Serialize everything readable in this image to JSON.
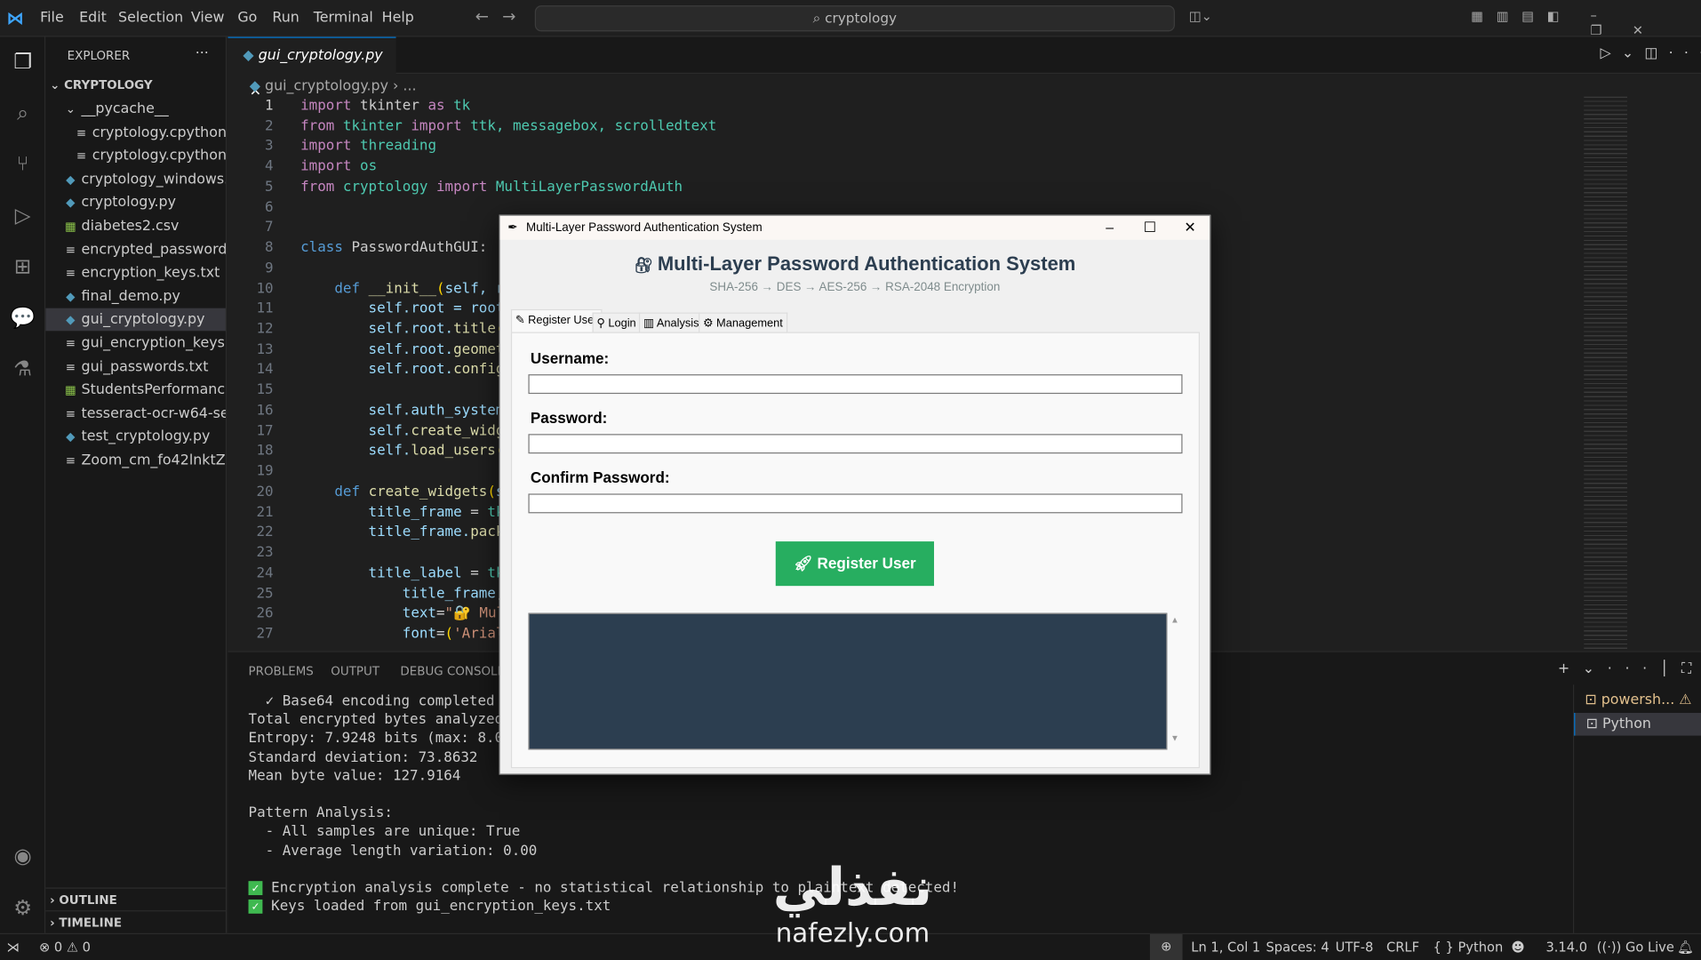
{
  "menu": [
    "File",
    "Edit",
    "Selection",
    "View",
    "Go",
    "Run",
    "Terminal",
    "Help"
  ],
  "search": "cryptology",
  "explorer": {
    "title": "EXPLORER",
    "root": "CRYPTOLOGY",
    "items": [
      {
        "label": "__pycache__",
        "type": "folder",
        "indent": 1
      },
      {
        "label": "cryptology.cpython-...",
        "type": "txt",
        "indent": 2
      },
      {
        "label": "cryptology.cpython-...",
        "type": "txt",
        "indent": 2
      },
      {
        "label": "cryptology_windows.py",
        "type": "py",
        "indent": 1
      },
      {
        "label": "cryptology.py",
        "type": "py",
        "indent": 1
      },
      {
        "label": "diabetes2.csv",
        "type": "csv",
        "indent": 1
      },
      {
        "label": "encrypted_passwords...",
        "type": "txt",
        "indent": 1
      },
      {
        "label": "encryption_keys.txt",
        "type": "txt",
        "indent": 1
      },
      {
        "label": "final_demo.py",
        "type": "py",
        "indent": 1
      },
      {
        "label": "gui_cryptology.py",
        "type": "py",
        "indent": 1,
        "selected": true
      },
      {
        "label": "gui_encryption_keys.txt",
        "type": "txt",
        "indent": 1
      },
      {
        "label": "gui_passwords.txt",
        "type": "txt",
        "indent": 1
      },
      {
        "label": "StudentsPerformance....",
        "type": "csv",
        "indent": 1
      },
      {
        "label": "tesseract-ocr-w64-set...",
        "type": "txt",
        "indent": 1
      },
      {
        "label": "test_cryptology.py",
        "type": "py",
        "indent": 1
      },
      {
        "label": "Zoom_cm_fo42lnktZ9...",
        "type": "txt",
        "indent": 1
      }
    ],
    "outline": "OUTLINE",
    "timeline": "TIMELINE"
  },
  "editor": {
    "tab": "gui_cryptology.py",
    "breadcrumb": "gui_cryptology.py",
    "breadcrumb_more": "...",
    "lines": [
      [
        [
          "import",
          "kw"
        ],
        [
          " tkinter ",
          ""
        ],
        [
          "as",
          "kw"
        ],
        [
          " tk",
          "cls"
        ]
      ],
      [
        [
          "from",
          "kw"
        ],
        [
          " tkinter ",
          "cls"
        ],
        [
          "import",
          "kw"
        ],
        [
          " ttk, messagebox, scrolledtext",
          "cls"
        ]
      ],
      [
        [
          "import",
          "kw"
        ],
        [
          " threading",
          "cls"
        ]
      ],
      [
        [
          "import",
          "kw"
        ],
        [
          " os",
          "cls"
        ]
      ],
      [
        [
          "from",
          "kw"
        ],
        [
          " cryptology ",
          "cls"
        ],
        [
          "import",
          "kw"
        ],
        [
          " MultiLayerPasswordAuth",
          "cls"
        ]
      ],
      [],
      [],
      [
        [
          "class",
          "kb"
        ],
        [
          " PasswordAuthGUI",
          ""
        ],
        [
          ":",
          ""
        ]
      ],
      [],
      [
        [
          "    def",
          "kb"
        ],
        [
          " __init__",
          "fn"
        ],
        [
          "(",
          "pn"
        ],
        [
          "self, r",
          "sf"
        ]
      ],
      [
        [
          "        self",
          "sf"
        ],
        [
          ".root = ",
          "sf"
        ],
        [
          "root",
          "sf"
        ]
      ],
      [
        [
          "        self",
          "sf"
        ],
        [
          ".root.",
          "sf"
        ],
        [
          "title",
          "fn"
        ],
        [
          "(",
          "pn"
        ]
      ],
      [
        [
          "        self",
          "sf"
        ],
        [
          ".root.",
          "sf"
        ],
        [
          "geomet",
          "fn"
        ]
      ],
      [
        [
          "        self",
          "sf"
        ],
        [
          ".root.",
          "sf"
        ],
        [
          "config",
          "fn"
        ]
      ],
      [],
      [
        [
          "        self",
          "sf"
        ],
        [
          ".auth_system",
          "sf"
        ]
      ],
      [
        [
          "        self",
          "sf"
        ],
        [
          ".",
          "sf"
        ],
        [
          "create_widg",
          "fn"
        ]
      ],
      [
        [
          "        self",
          "sf"
        ],
        [
          ".",
          "sf"
        ],
        [
          "load_users",
          "fn"
        ],
        [
          "(",
          "pn"
        ]
      ],
      [],
      [
        [
          "    def",
          "kb"
        ],
        [
          " create_widgets",
          "fn"
        ],
        [
          "(",
          "pn"
        ],
        [
          "s",
          "sf"
        ]
      ],
      [
        [
          "        title_frame",
          "sf"
        ],
        [
          " = ",
          ""
        ],
        [
          "tk",
          "cls"
        ]
      ],
      [
        [
          "        title_frame",
          "sf"
        ],
        [
          ".",
          "sf"
        ],
        [
          "pack",
          "fn"
        ]
      ],
      [],
      [
        [
          "        title_label",
          "sf"
        ],
        [
          " = ",
          ""
        ],
        [
          "tk",
          "cls"
        ]
      ],
      [
        [
          "            title_frame",
          "sf"
        ],
        [
          ",",
          ""
        ]
      ],
      [
        [
          "            text",
          "sf"
        ],
        [
          "=",
          ""
        ],
        [
          "\"🔐 Mul",
          "st"
        ]
      ],
      [
        [
          "            font",
          "sf"
        ],
        [
          "=",
          ""
        ],
        [
          "(",
          "pn"
        ],
        [
          "'Arial",
          "st"
        ]
      ]
    ]
  },
  "panel": {
    "tabs": [
      "PROBLEMS",
      "OUTPUT",
      "DEBUG CONSOLE"
    ],
    "terminal": [
      "  ✓ Base64 encoding completed",
      "Total encrypted bytes analyzed:",
      "Entropy: 7.9248 bits (max: 8.0)",
      "Standard deviation: 73.8632",
      "Mean byte value: 127.9164",
      "",
      "Pattern Analysis:",
      "  - All samples are unique: True",
      "  - Average length variation: 0.00",
      ""
    ],
    "checks": [
      "Encryption analysis complete - no statistical relationship to plaintext detected!",
      "Keys loaded from gui_encryption_keys.txt"
    ],
    "terminals": [
      "powersh...",
      "Python"
    ]
  },
  "dialog": {
    "window_title": "Multi-Layer Password Authentication System",
    "heading": "Multi-Layer Password Authentication System",
    "subtitle": "SHA-256 → DES → AES-256 → RSA-2048 Encryption",
    "tabs": [
      "Register User",
      "Login",
      "Analysis",
      "Management"
    ],
    "labels": [
      "Username:",
      "Password:",
      "Confirm Password:"
    ],
    "values": [
      "",
      "",
      ""
    ],
    "button": "Register User",
    "colors": {
      "button": "#27ae60",
      "output": "#2c3e50"
    }
  },
  "status": {
    "errors": "0",
    "warnings": "0",
    "position": "Ln 1, Col 1",
    "spaces": "Spaces: 4",
    "encoding": "UTF-8",
    "eol": "CRLF",
    "language": "Python",
    "version": "3.14.0",
    "golive": "Go Live"
  },
  "watermark": {
    "arabic": "نفذلي",
    "latin": "nafezly.com"
  }
}
